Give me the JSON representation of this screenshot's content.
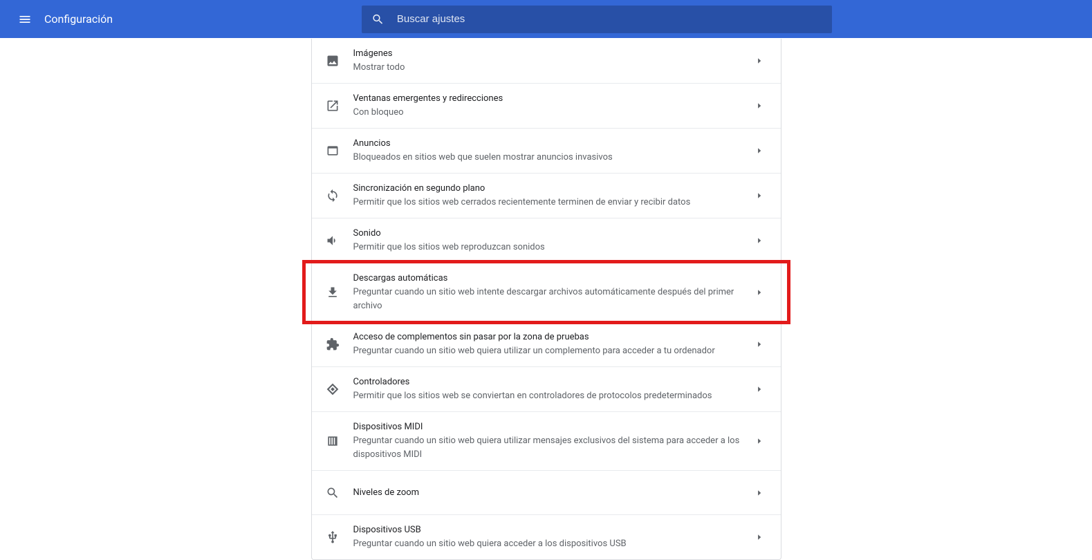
{
  "header": {
    "title": "Configuración",
    "search_placeholder": "Buscar ajustes"
  },
  "settings": [
    {
      "icon": "image",
      "title": "Imágenes",
      "subtitle": "Mostrar todo"
    },
    {
      "icon": "launch",
      "title": "Ventanas emergentes y redirecciones",
      "subtitle": "Con bloqueo"
    },
    {
      "icon": "tab",
      "title": "Anuncios",
      "subtitle": "Bloqueados en sitios web que suelen mostrar anuncios invasivos"
    },
    {
      "icon": "sync",
      "title": "Sincronización en segundo plano",
      "subtitle": "Permitir que los sitios web cerrados recientemente terminen de enviar y recibir datos"
    },
    {
      "icon": "sound",
      "title": "Sonido",
      "subtitle": "Permitir que los sitios web reproduzcan sonidos"
    },
    {
      "icon": "download",
      "title": "Descargas automáticas",
      "subtitle": "Preguntar cuando un sitio web intente descargar archivos automáticamente después del primer archivo",
      "highlighted": true
    },
    {
      "icon": "extension",
      "title": "Acceso de complementos sin pasar por la zona de pruebas",
      "subtitle": "Preguntar cuando un sitio web quiera utilizar un complemento para acceder a tu ordenador"
    },
    {
      "icon": "handlers",
      "title": "Controladores",
      "subtitle": "Permitir que los sitios web se conviertan en controladores de protocolos predeterminados"
    },
    {
      "icon": "midi",
      "title": "Dispositivos MIDI",
      "subtitle": "Preguntar cuando un sitio web quiera utilizar mensajes exclusivos del sistema para acceder a los dispositivos MIDI"
    },
    {
      "icon": "zoom",
      "title": "Niveles de zoom",
      "subtitle": ""
    },
    {
      "icon": "usb",
      "title": "Dispositivos USB",
      "subtitle": "Preguntar cuando un sitio web quiera acceder a los dispositivos USB"
    }
  ],
  "colors": {
    "accent": "#3367d6",
    "highlight": "#e21b1b"
  }
}
